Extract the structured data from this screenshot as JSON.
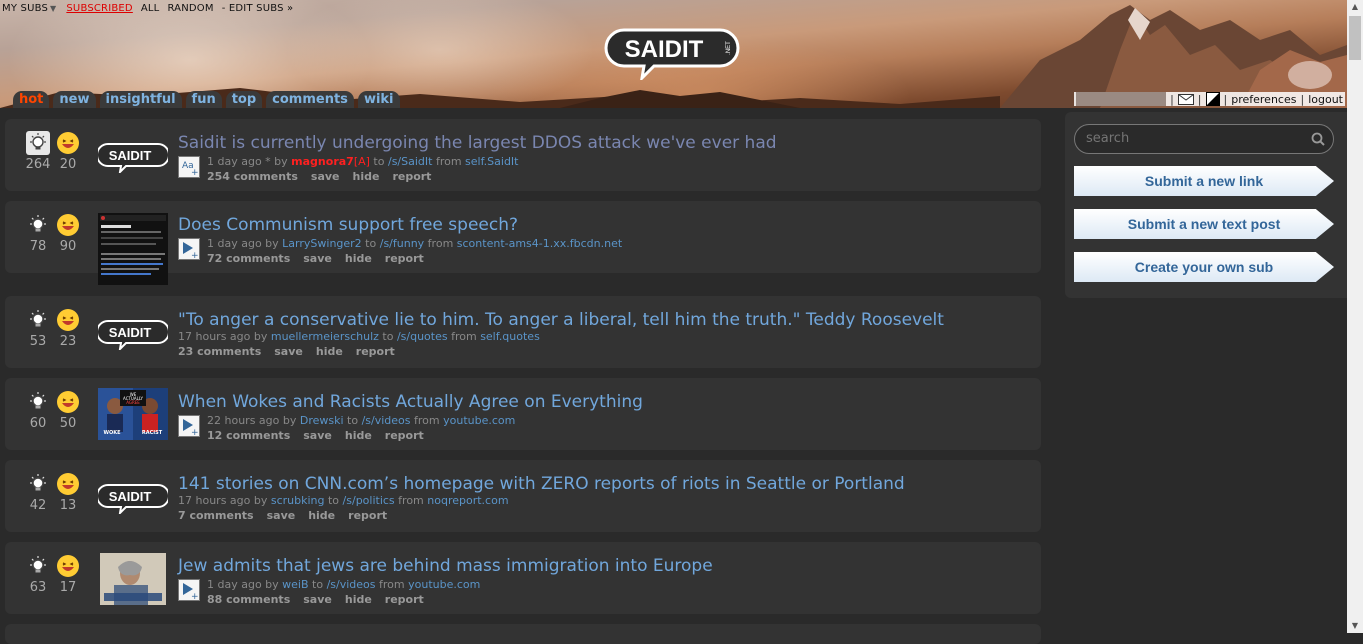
{
  "top_nav": {
    "my_subs": "MY SUBS",
    "subscribed": "SUBSCRIBED",
    "all": "ALL",
    "random": "RANDOM",
    "edit_subs": "- EDIT SUBS »"
  },
  "logo": {
    "text": "SAIDIT",
    "suffix": ".NET"
  },
  "tabs": [
    "hot",
    "new",
    "insightful",
    "fun",
    "top",
    "comments",
    "wiki"
  ],
  "selected_tab": "hot",
  "user_bar": {
    "preferences": "preferences",
    "logout": "logout",
    "separator": "|"
  },
  "sidebar": {
    "search_placeholder": "search",
    "submit_link": "Submit a new link",
    "submit_text": "Submit a new text post",
    "create_sub": "Create your own sub"
  },
  "posts": [
    {
      "insightful": "264",
      "fun": "20",
      "title": "Saidit is currently undergoing the largest DDOS attack we've ever had",
      "time": "1 day ago * by ",
      "user": "magnora7",
      "mod_tag": "[A]",
      "to": " to ",
      "sub": "/s/SaidIt",
      "from": " from ",
      "domain": "self.SaidIt",
      "comments": "254 comments",
      "save": "save",
      "hide": "hide",
      "report": "report",
      "thumb": "saidit-logo",
      "expando": "text"
    },
    {
      "insightful": "78",
      "fun": "90",
      "title": "Does Communism support free speech?",
      "time": "1 day ago by ",
      "user": "LarrySwinger2",
      "to": " to ",
      "sub": "/s/funny",
      "from": " from ",
      "domain": "scontent-ams4-1.xx.fbcdn.net",
      "comments": "72 comments",
      "save": "save",
      "hide": "hide",
      "report": "report",
      "thumb": "screenshot",
      "expando": "media"
    },
    {
      "insightful": "53",
      "fun": "23",
      "title": "\"To anger a conservative lie to him. To anger a liberal, tell him the truth.\" Teddy Roosevelt",
      "time": "17 hours ago by ",
      "user": "muellermeierschulz",
      "to": " to ",
      "sub": "/s/quotes",
      "from": " from ",
      "domain": "self.quotes",
      "comments": "23 comments",
      "save": "save",
      "hide": "hide",
      "report": "report",
      "thumb": "saidit-logo",
      "expando": "none"
    },
    {
      "insightful": "60",
      "fun": "50",
      "title": "When Wokes and Racists Actually Agree on Everything",
      "time": "22 hours ago by ",
      "user": "Drewski",
      "to": " to ",
      "sub": "/s/videos",
      "from": " from ",
      "domain": "youtube.com",
      "comments": "12 comments",
      "save": "save",
      "hide": "hide",
      "report": "report",
      "thumb": "video",
      "expando": "media",
      "thumb_labels": [
        "WE",
        "ACTUALLY",
        "AGREE",
        "WOKE",
        "RACIST"
      ]
    },
    {
      "insightful": "42",
      "fun": "13",
      "title": "141 stories on CNN.com’s homepage with ZERO reports of riots in Seattle or Portland",
      "time": "17 hours ago by ",
      "user": "scrubking",
      "to": " to ",
      "sub": "/s/politics",
      "from": " from ",
      "domain": "noqreport.com",
      "comments": "7 comments",
      "save": "save",
      "hide": "hide",
      "report": "report",
      "thumb": "saidit-logo",
      "expando": "none"
    },
    {
      "insightful": "63",
      "fun": "17",
      "title": "Jew admits that jews are behind mass immigration into Europe",
      "time": "1 day ago by ",
      "user": "weiB",
      "to": " to ",
      "sub": "/s/videos",
      "from": " from ",
      "domain": "youtube.com",
      "comments": "88 comments",
      "save": "save",
      "hide": "hide",
      "report": "report",
      "thumb": "person",
      "expando": "media"
    }
  ],
  "colors": {
    "accent": "#71a7dc",
    "selected_tab": "#ff4500",
    "admin": "#ff2020",
    "post_bg": "#333333",
    "page_bg": "#2a2a2a"
  }
}
